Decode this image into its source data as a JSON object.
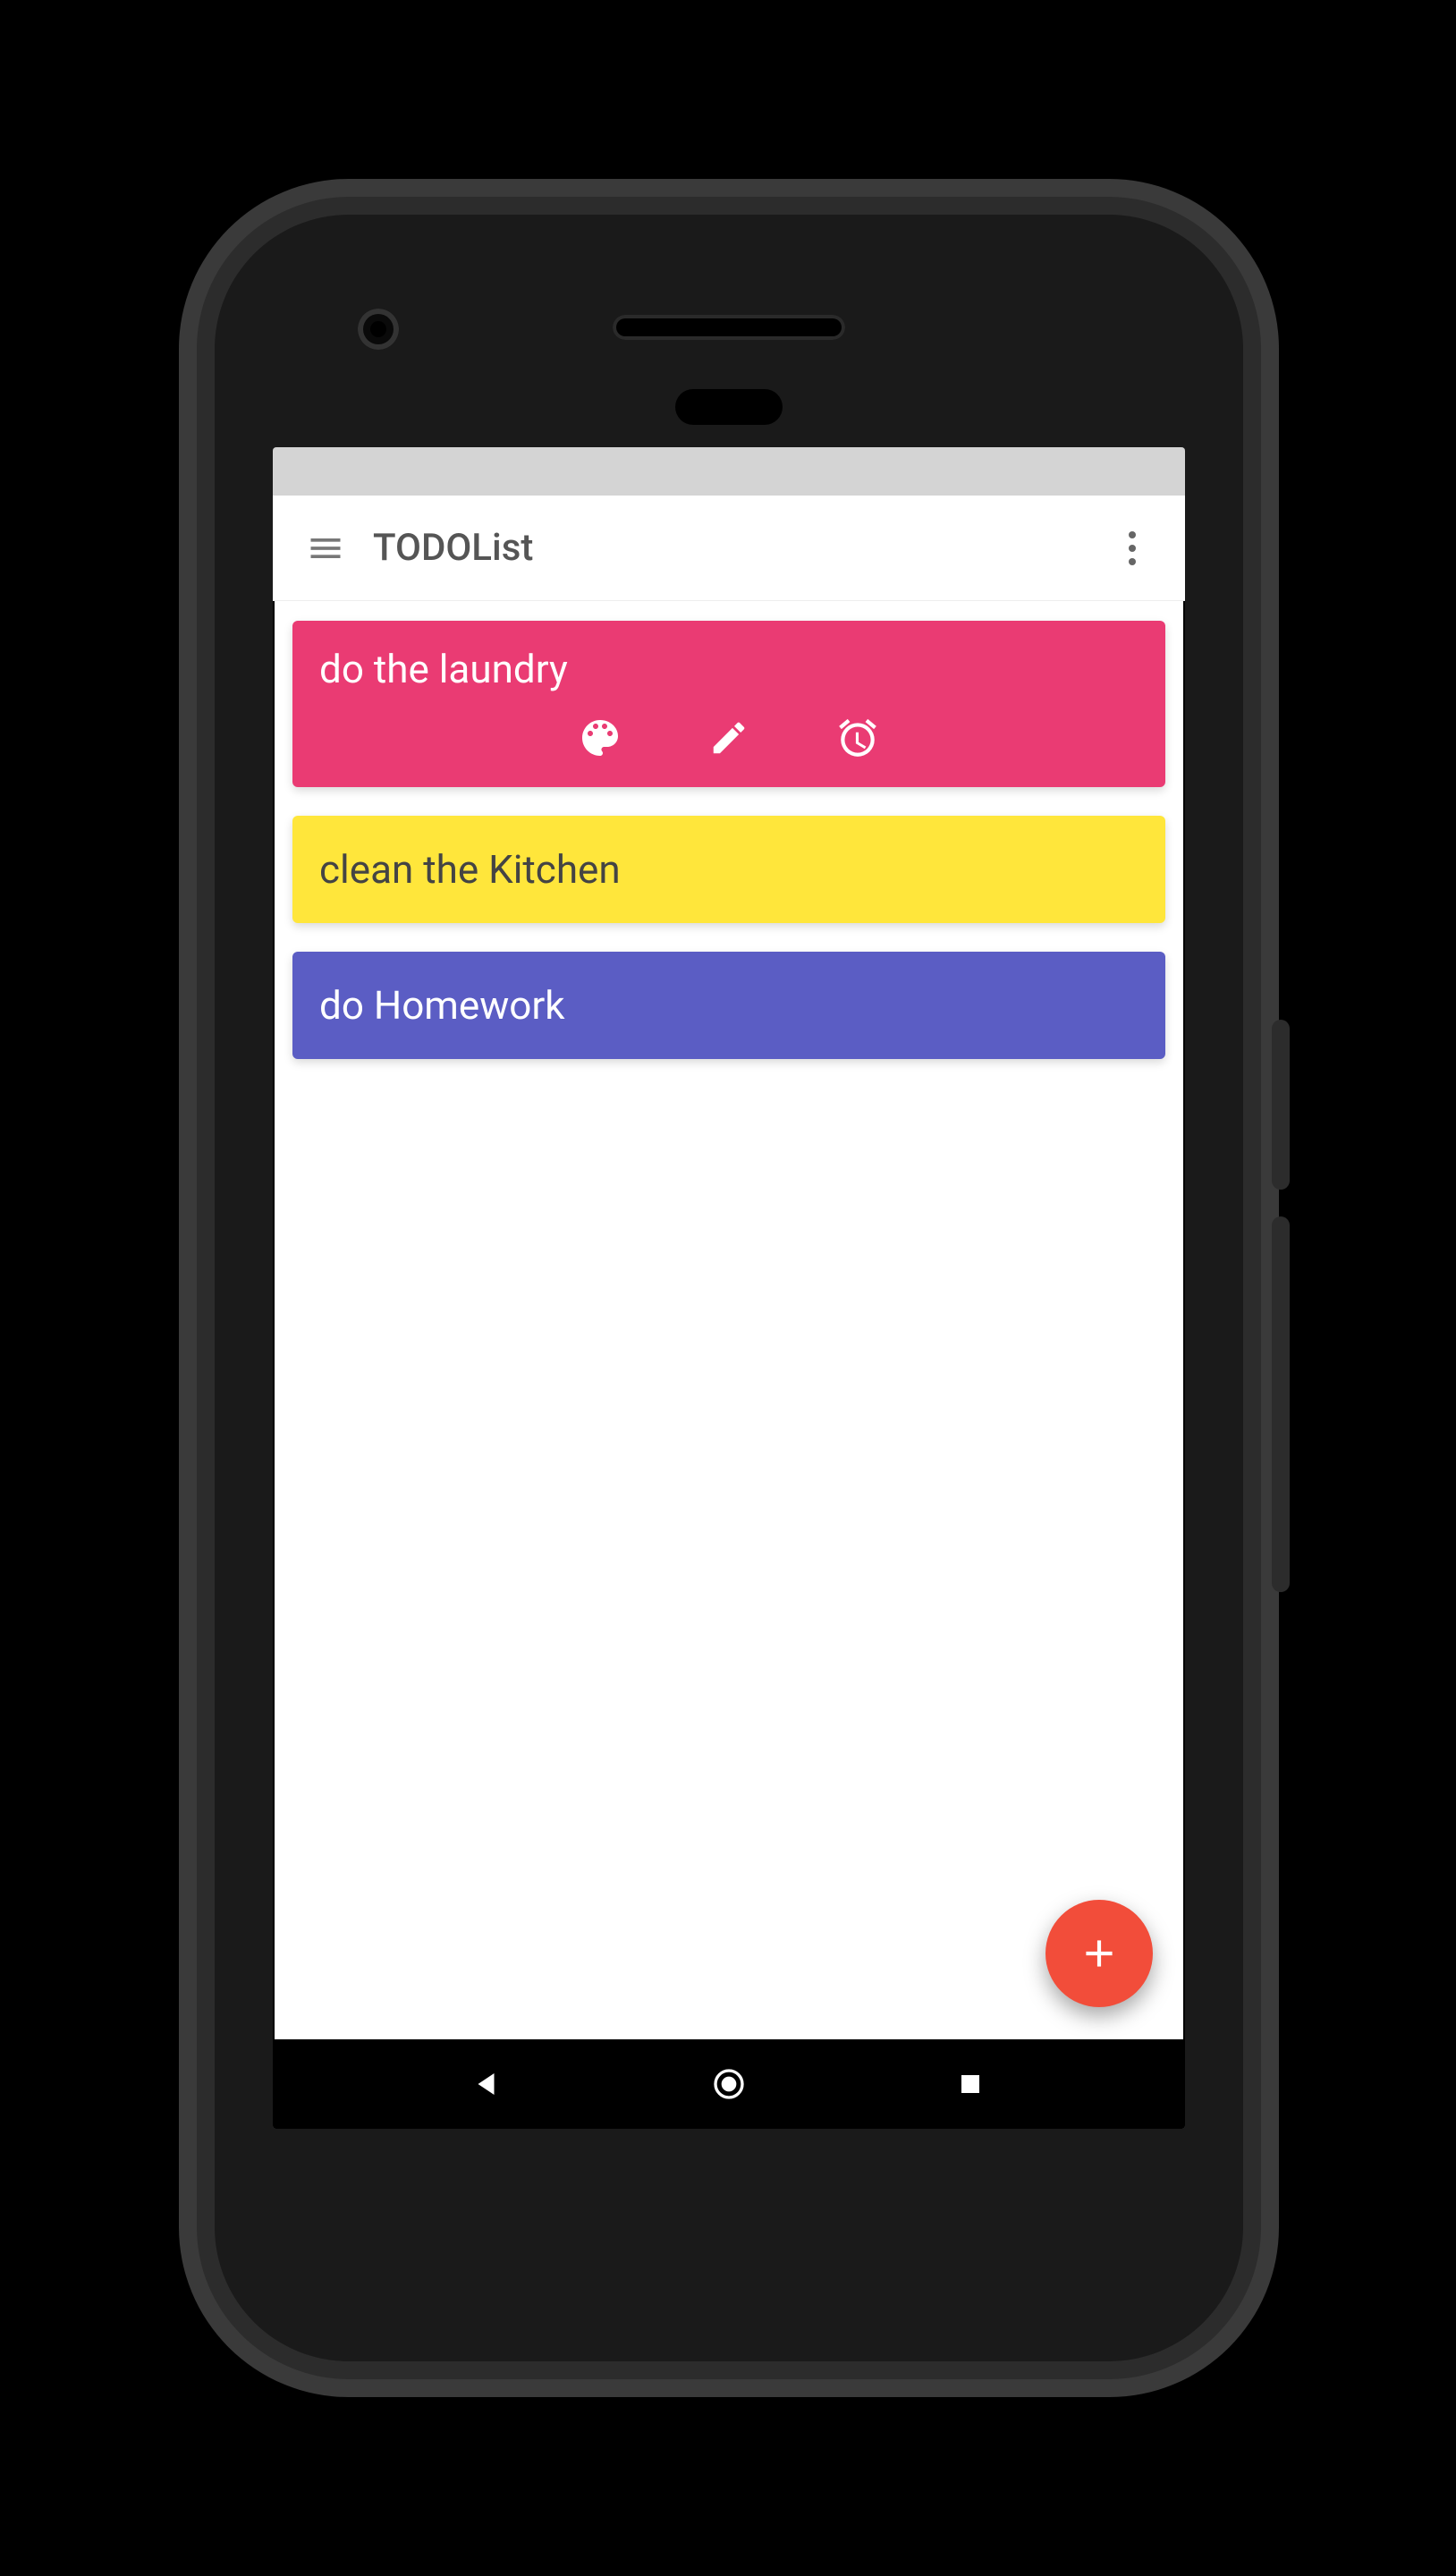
{
  "appbar": {
    "title": "TODOList"
  },
  "fab": {
    "label": "+"
  },
  "colors": {
    "pink": "#ea3b73",
    "yellow": "#ffe63b",
    "purple": "#5b5dc4",
    "fab": "#f24d3a"
  },
  "tasks": [
    {
      "label": "do the laundry",
      "color": "pink",
      "expanded": true
    },
    {
      "label": "clean the Kitchen",
      "color": "yellow",
      "expanded": false
    },
    {
      "label": "do Homework",
      "color": "purple",
      "expanded": false
    }
  ],
  "task_actions": [
    {
      "icon": "palette-icon"
    },
    {
      "icon": "pencil-icon"
    },
    {
      "icon": "alarm-icon"
    }
  ]
}
